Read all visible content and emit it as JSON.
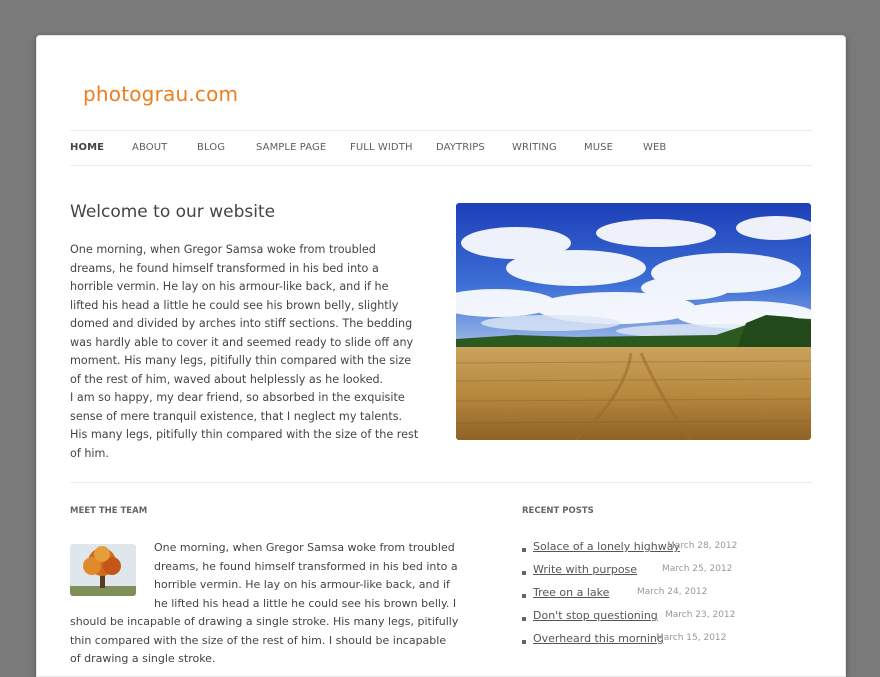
{
  "site": {
    "title": "photograu.com"
  },
  "nav": {
    "items": [
      {
        "label": "HOME",
        "active": true
      },
      {
        "label": "ABOUT"
      },
      {
        "label": "BLOG"
      },
      {
        "label": "SAMPLE PAGE"
      },
      {
        "label": "FULL WIDTH"
      },
      {
        "label": "DAYTRIPS"
      },
      {
        "label": "WRITING"
      },
      {
        "label": "MUSE"
      },
      {
        "label": "WEB"
      }
    ]
  },
  "main": {
    "title": "Welcome to our website",
    "paragraph1": "One morning, when Gregor Samsa woke from troubled dreams, he found himself transformed in his bed into a horrible vermin. He lay on his armour-like back, and if he lifted his head a little he could see his brown belly, slightly domed and divided by arches into stiff sections. The bedding was hardly able to cover it and seemed ready to slide off any moment. His many legs, pitifully thin compared with the size of the rest of him, waved about helplessly as he looked.",
    "paragraph2": "I am so happy, my dear friend, so absorbed in the exquisite sense of mere tranquil existence, that I neglect my talents. His many legs, pitifully thin compared with the size of the rest of him."
  },
  "team": {
    "heading": "MEET THE TEAM",
    "text": "One morning, when Gregor Samsa woke from troubled dreams, he found himself transformed in his bed into a horrible vermin. He lay on his armour-like back, and if he lifted his head a little he could see his brown belly. I should be incapable of drawing a single stroke. His many legs, pitifully thin compared with the size of the rest of him. I should be incapable of drawing a single stroke."
  },
  "recent_posts": {
    "heading": "RECENT POSTS",
    "items": [
      {
        "title": "Solace of a lonely highway",
        "date": "March 28, 2012"
      },
      {
        "title": "Write with purpose",
        "date": "March 25, 2012"
      },
      {
        "title": "Tree on a lake",
        "date": "March 24, 2012"
      },
      {
        "title": "Don't stop questioning",
        "date": "March 23, 2012"
      },
      {
        "title": "Overheard this morning",
        "date": "March 15, 2012"
      }
    ]
  },
  "colors": {
    "accent": "#ee7d1e",
    "backdrop": "#7a7a7a",
    "text": "#444444"
  }
}
